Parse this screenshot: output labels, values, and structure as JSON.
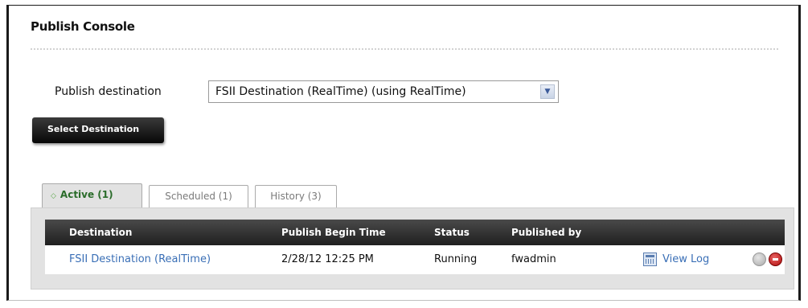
{
  "console": {
    "title": "Publish Console",
    "publish_destination_label": "Publish destination",
    "destination_select_value": "FSII Destination (RealTime) (using RealTime)",
    "select_button_label": "Select Destination"
  },
  "tabs": [
    {
      "label": "Active (1)",
      "active": true
    },
    {
      "label": "Scheduled (1)",
      "active": false
    },
    {
      "label": "History (3)",
      "active": false
    }
  ],
  "table": {
    "columns": [
      "Destination",
      "Publish Begin Time",
      "Status",
      "Published by"
    ],
    "rows": [
      {
        "destination": "FSII Destination (RealTime)",
        "begin_time": "2/28/12 12:25 PM",
        "status": "Running",
        "published_by": "fwadmin",
        "action_label": "View Log"
      }
    ]
  },
  "colors": {
    "link": "#3a6fb6",
    "active_tab_text": "#2a6c2a",
    "stop_button": "#b00f0f"
  },
  "icons": [
    "tab-active-indicator-icon",
    "view-log-icon",
    "pause-icon",
    "stop-icon",
    "dropdown-arrow-icon"
  ]
}
